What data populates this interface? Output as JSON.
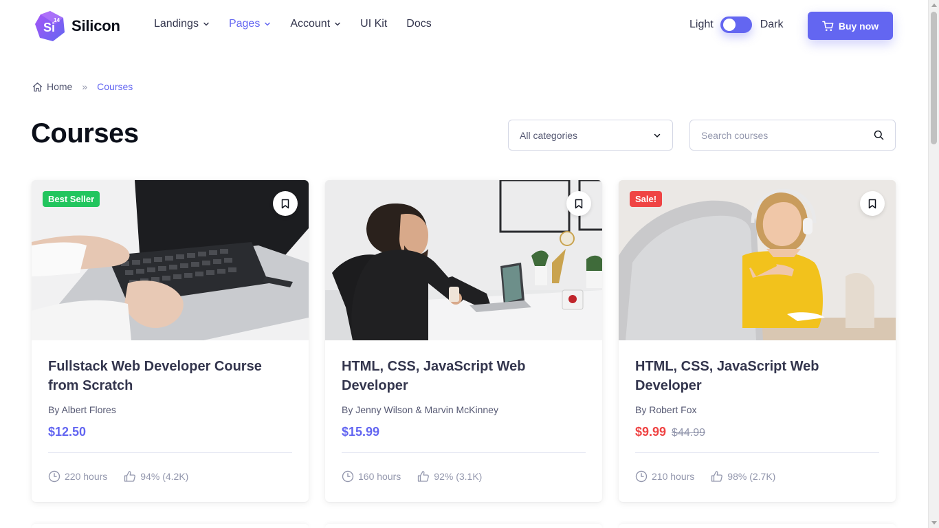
{
  "brand": {
    "name": "Silicon",
    "version_badge": "14",
    "mark_text": "Si"
  },
  "nav": {
    "items": [
      {
        "label": "Landings",
        "has_dropdown": true,
        "active": false
      },
      {
        "label": "Pages",
        "has_dropdown": true,
        "active": true
      },
      {
        "label": "Account",
        "has_dropdown": true,
        "active": false
      },
      {
        "label": "UI Kit",
        "has_dropdown": false,
        "active": false
      },
      {
        "label": "Docs",
        "has_dropdown": false,
        "active": false
      }
    ]
  },
  "theme_switch": {
    "light_label": "Light",
    "dark_label": "Dark",
    "state": "light"
  },
  "buy_button": {
    "label": "Buy now",
    "icon": "cart-icon"
  },
  "breadcrumb": {
    "home": "Home",
    "separator": "»",
    "current": "Courses"
  },
  "page": {
    "title": "Courses"
  },
  "filters": {
    "category_select": {
      "value": "All categories"
    },
    "search": {
      "placeholder": "Search courses"
    }
  },
  "courses": [
    {
      "title": "Fullstack Web Developer Course from Scratch",
      "author": "By Albert Flores",
      "price": "$12.50",
      "old_price": "",
      "badge": "Best Seller",
      "hours": "220 hours",
      "rating": "94% (4.2K)"
    },
    {
      "title": "HTML, CSS, JavaScript Web Developer",
      "author": "By Jenny Wilson & Marvin McKinney",
      "price": "$15.99",
      "old_price": "",
      "badge": "",
      "hours": "160 hours",
      "rating": "92% (3.1K)"
    },
    {
      "title": "HTML, CSS, JavaScript Web Developer",
      "author": "By Robert Fox",
      "price": "$9.99",
      "old_price": "$44.99",
      "badge": "Sale!",
      "hours": "210 hours",
      "rating": "98% (2.7K)"
    }
  ],
  "colors": {
    "primary": "#6366f1",
    "heading": "#0b0f19",
    "body": "#565973",
    "muted": "#9397ad",
    "success": "#22c55e",
    "danger": "#ef4444"
  }
}
